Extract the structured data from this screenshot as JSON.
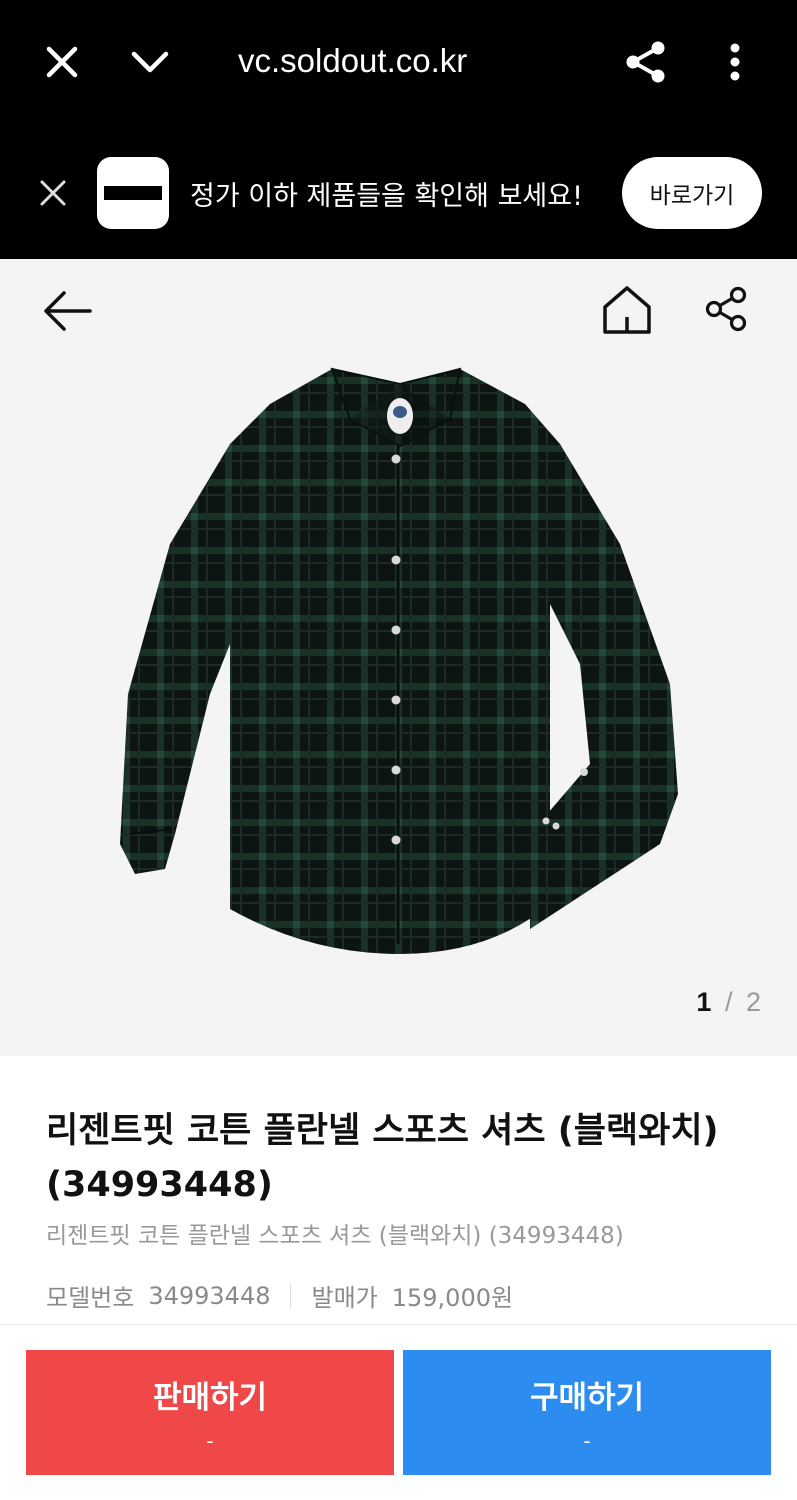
{
  "browser": {
    "url": "vc.soldout.co.kr",
    "icons": [
      "close-icon",
      "chevron-down-icon",
      "share-icon",
      "more-vertical-icon"
    ]
  },
  "promo": {
    "message": "정가 이하 제품들을 확인해 보세요!",
    "button_label": "바로가기",
    "icons": [
      "close-icon",
      "app-logo"
    ]
  },
  "gallery": {
    "current": "1",
    "separator": "/",
    "total": "2",
    "icons": [
      "back-arrow-icon",
      "home-icon",
      "share-icon"
    ],
    "image": "plaid-shirt"
  },
  "product": {
    "title": "리젠트핏 코튼 플란넬 스포츠 셔츠 (블랙와치) (34993448)",
    "subtitle": "리젠트핏 코튼 플란넬 스포츠 셔츠 (블랙와치) (34993448)",
    "model_label": "모델번호",
    "model_value": "34993448",
    "price_label": "발매가",
    "price_value": "159,000원"
  },
  "actions": {
    "sell_label": "판매하기",
    "sell_price": "-",
    "buy_label": "구매하기",
    "buy_price": "-"
  },
  "colors": {
    "sell": "#f04848",
    "buy": "#2d8cf0",
    "banner_bg": "#000000",
    "image_bg": "#f4f4f4"
  }
}
